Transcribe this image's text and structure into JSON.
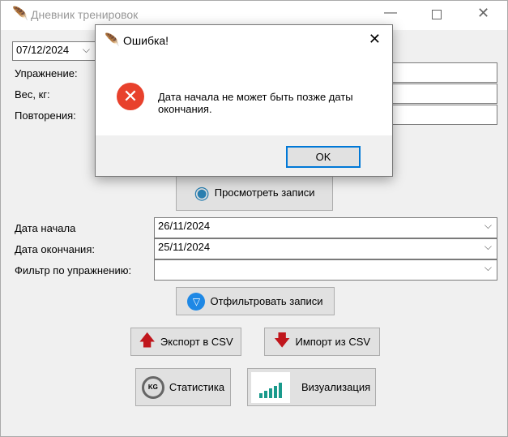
{
  "window": {
    "title": "Дневник тренировок"
  },
  "form": {
    "date": "07/12/2024",
    "exercise_label": "Упражнение:",
    "weight_label": "Вес, кг:",
    "reps_label": "Повторения:"
  },
  "buttons": {
    "view": "Просмотреть записи",
    "filter": "Отфильтровать записи",
    "export": "Экспорт в CSV",
    "import": "Импорт из CSV",
    "stats": "Статистика",
    "viz": "Визуализация"
  },
  "filter": {
    "start_label": "Дата начала",
    "start_value": "26/11/2024",
    "end_label": "Дата окончания:",
    "end_value": "25/11/2024",
    "exercise_label": "Фильтр по упражнению:",
    "exercise_value": ""
  },
  "dialog": {
    "title": "Ошибка!",
    "message": "Дата начала не может быть позже даты окончания.",
    "ok": "OK"
  },
  "colors": {
    "error": "#e8412c",
    "accent": "#0078d7"
  }
}
